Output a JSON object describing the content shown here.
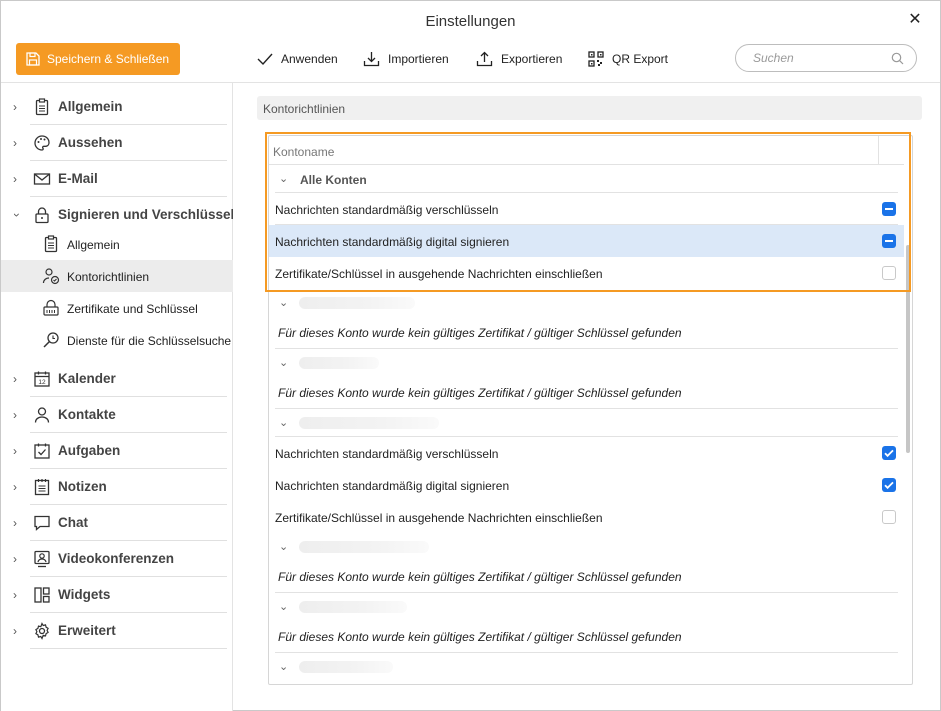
{
  "window": {
    "title": "Einstellungen"
  },
  "toolbar": {
    "save_label": "Speichern & Schließen",
    "apply_label": "Anwenden",
    "import_label": "Importieren",
    "export_label": "Exportieren",
    "qr_label": "QR Export",
    "search_placeholder": "Suchen"
  },
  "sidebar": {
    "items": [
      {
        "label": "Allgemein",
        "icon": "clipboard-icon"
      },
      {
        "label": "Aussehen",
        "icon": "palette-icon"
      },
      {
        "label": "E-Mail",
        "icon": "envelope-icon"
      },
      {
        "label": "Signieren und Verschlüsselung",
        "icon": "lock-icon"
      },
      {
        "label": "Kalender",
        "icon": "calendar-icon"
      },
      {
        "label": "Kontakte",
        "icon": "person-icon"
      },
      {
        "label": "Aufgaben",
        "icon": "task-icon"
      },
      {
        "label": "Notizen",
        "icon": "notes-icon"
      },
      {
        "label": "Chat",
        "icon": "chat-icon"
      },
      {
        "label": "Videokonferenzen",
        "icon": "video-icon"
      },
      {
        "label": "Widgets",
        "icon": "widgets-icon"
      },
      {
        "label": "Erweitert",
        "icon": "gear-icon"
      }
    ],
    "subitems": [
      {
        "label": "Allgemein",
        "icon": "clipboard-icon"
      },
      {
        "label": "Kontorichtlinien",
        "icon": "user-shield-icon"
      },
      {
        "label": "Zertifikate und Schlüssel",
        "icon": "certificate-icon"
      },
      {
        "label": "Dienste für die Schlüsselsuche",
        "icon": "key-search-icon"
      }
    ]
  },
  "content": {
    "section_title": "Kontorichtlinien",
    "column_header": "Kontoname",
    "all_accounts": "Alle Konten",
    "rows": {
      "encrypt": "Nachrichten standardmäßig verschlüsseln",
      "sign": "Nachrichten standardmäßig digital signieren",
      "include_cert": "Zertifikate/Schlüssel in ausgehende Nachrichten einschließen",
      "no_cert": "Für dieses Konto wurde kein gültiges Zertifikat / gültiger Schlüssel gefunden"
    }
  },
  "colors": {
    "accent": "#f59a23",
    "checkbox": "#1a73e8",
    "selected_row": "#dbe8f8"
  }
}
